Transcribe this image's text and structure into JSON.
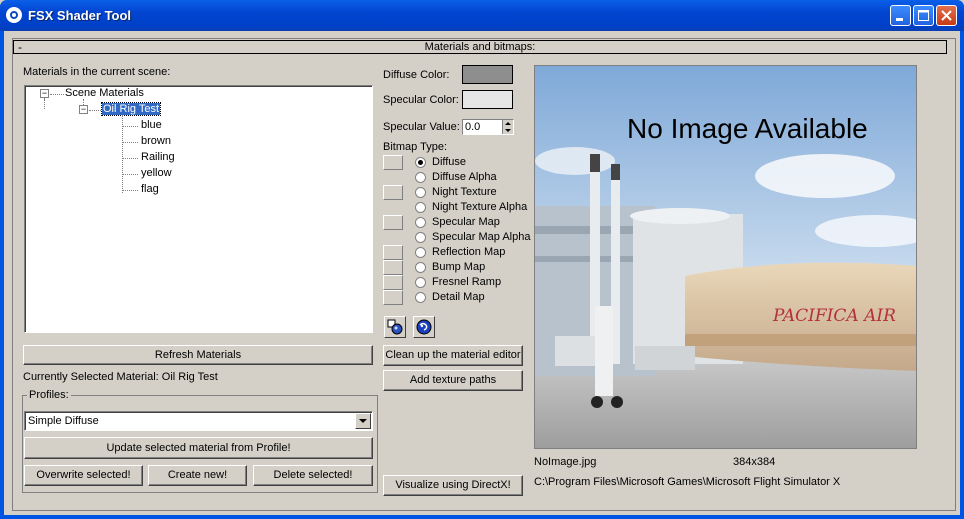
{
  "window": {
    "title": "FSX Shader Tool",
    "minimize_icon": "minimize-icon",
    "maximize_icon": "maximize-icon",
    "close_icon": "close-icon"
  },
  "rollout": {
    "collapse_symbol": "-",
    "title": "Materials and bitmaps:"
  },
  "materials": {
    "label": "Materials in the current scene:",
    "tree": {
      "root": "Scene Materials",
      "selected": "Oil Rig Test",
      "children": [
        "blue",
        "brown",
        "Railing",
        "yellow",
        "flag"
      ]
    },
    "refresh_button": "Refresh Materials",
    "current_selection": "Currently Selected Material: Oil Rig Test"
  },
  "profiles": {
    "group_title": "Profiles:",
    "selected": "Simple Diffuse",
    "update_button": "Update selected material from Profile!",
    "overwrite_button": "Overwrite selected!",
    "create_button": "Create new!",
    "delete_button": "Delete selected!"
  },
  "colors": {
    "diffuse_label": "Diffuse Color:",
    "diffuse_value": "#8e8e8e",
    "specular_label": "Specular Color:",
    "specular_value": "#e6e6e6",
    "specular_value_label": "Specular Value:",
    "specular_value_number": "0.0"
  },
  "bitmap": {
    "type_label": "Bitmap Type:",
    "options": [
      "Diffuse",
      "Diffuse Alpha",
      "Night Texture",
      "Night Texture Alpha",
      "Specular Map",
      "Specular Map Alpha",
      "Reflection Map",
      "Bump Map",
      "Fresnel Ramp",
      "Detail Map"
    ],
    "selected_index": 0
  },
  "actions": {
    "cleanup_button": "Clean up the material editor",
    "add_paths_button": "Add texture paths",
    "visualize_button": "Visualize using DirectX!",
    "icon1": "material-editor-icon",
    "icon2": "globe-icon"
  },
  "preview": {
    "overlay_text": "No Image Available",
    "livery_text": "PACIFICA AIR",
    "filename": "NoImage.jpg",
    "dimensions": "384x384",
    "path": "C:\\Program Files\\Microsoft Games\\Microsoft Flight Simulator X"
  }
}
